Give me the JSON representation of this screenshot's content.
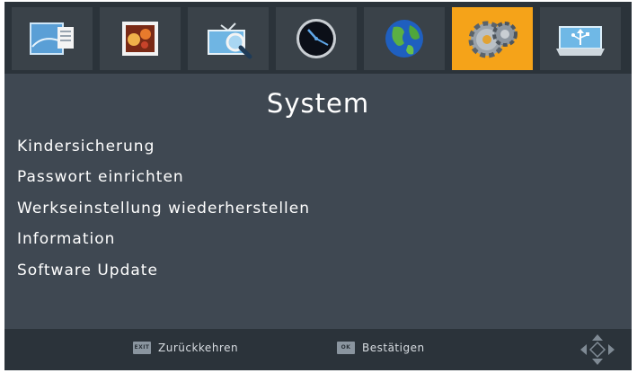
{
  "icon_bar": {
    "tabs": [
      {
        "icon": "display-settings-icon",
        "active": false
      },
      {
        "icon": "photo-media-icon",
        "active": false
      },
      {
        "icon": "tv-search-icon",
        "active": false
      },
      {
        "icon": "clock-icon",
        "active": false
      },
      {
        "icon": "globe-icon",
        "active": false
      },
      {
        "icon": "gears-system-icon",
        "active": true
      },
      {
        "icon": "usb-icon",
        "active": false
      }
    ]
  },
  "page": {
    "title": "System"
  },
  "menu": {
    "items": [
      {
        "label": "Kindersicherung"
      },
      {
        "label": "Passwort einrichten"
      },
      {
        "label": "Werkseinstellung wiederherstellen"
      },
      {
        "label": "Information"
      },
      {
        "label": "Software Update"
      }
    ]
  },
  "footer": {
    "exit_key": "EXIT",
    "exit_label": "Zurückkehren",
    "ok_key": "OK",
    "ok_label": "Bestätigen",
    "nav_icon": "direction-pad-icon"
  },
  "colors": {
    "background": "#3f4852",
    "bar": "#2b333a",
    "tab": "#3a4249",
    "active_tab": "#f5a319",
    "text": "#ffffff"
  }
}
